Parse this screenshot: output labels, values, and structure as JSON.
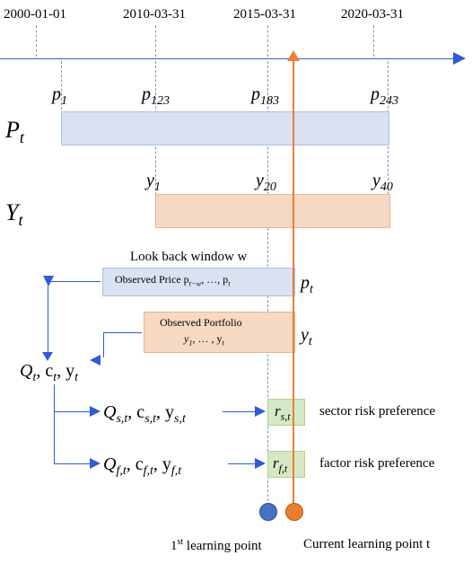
{
  "dates": {
    "d1": "2000-01-01",
    "d2": "2010-03-31",
    "d3": "2015-03-31",
    "d4": "2020-03-31"
  },
  "p_labels": {
    "p1": "p",
    "p1_sub": "1",
    "p2": "p",
    "p2_sub": "123",
    "p3": "p",
    "p3_sub": "183",
    "p4": "p",
    "p4_sub": "243"
  },
  "series": {
    "Pt": "P",
    "Pt_sub": "t",
    "Yt": "Y",
    "Yt_sub": "t"
  },
  "y_labels": {
    "y1": "y",
    "y1_sub": "1",
    "y2": "y",
    "y2_sub": "20",
    "y3": "y",
    "y3_sub": "40"
  },
  "lookback": {
    "title": "Look back window w",
    "observed_price": "Observed Price   p",
    "observed_price_sub1": "t−w",
    "observed_price_mid": ", …, p",
    "observed_price_sub2": "t",
    "observed_portfolio": "Observed Portfolio",
    "observed_portfolio_items": "y",
    "observed_portfolio_sub1": "1",
    "observed_portfolio_mid": ", … , y",
    "observed_portfolio_sub2": "t",
    "pt": "p",
    "pt_sub": "t",
    "yt": "y",
    "yt_sub": "t"
  },
  "qline": {
    "triple": "Q",
    "triple_sub": "t",
    "triple_c": ", c",
    "triple_c_sub": "t",
    "triple_y": ", y",
    "triple_y_sub": "t"
  },
  "sector": {
    "expr": "Q",
    "q_sub": "s,t",
    "c": ", c",
    "c_sub": "s,t",
    "y": ", y",
    "y_sub": "s,t",
    "r": "r",
    "r_sub": "s,t",
    "label": "sector risk preference"
  },
  "factor": {
    "expr": "Q",
    "q_sub": "f,t",
    "c": ", c",
    "c_sub": "f,t",
    "y": ", y",
    "y_sub": "f,t",
    "r": "r",
    "r_sub": "f,t",
    "label": "factor risk preference"
  },
  "legend": {
    "first": "1",
    "first_sup": "st",
    "first_rest": " learning point",
    "current": "Current learning point t"
  },
  "chart_data": {
    "type": "diagram-timeline",
    "time_axis_dates": [
      "2000-01-01",
      "2010-03-31",
      "2015-03-31",
      "2020-03-31"
    ],
    "price_indices_at_dates": [
      1,
      123,
      183,
      243
    ],
    "portfolio_indices_at_dates": [
      null,
      1,
      20,
      40
    ],
    "price_series_range": [
      1,
      243
    ],
    "portfolio_series_range": [
      1,
      40
    ],
    "lookback_window_symbol": "w",
    "derived": [
      "Q_t, c_t, y_t",
      "Q_{s,t}, c_{s,t}, y_{s,t}",
      "Q_{f,t}, c_{f,t}, y_{f,t}"
    ],
    "outputs": [
      "r_{s,t}",
      "r_{f,t}"
    ],
    "markers": {
      "first_learning_point": "blue-circle",
      "current_learning_point_t": "orange-circle"
    }
  }
}
